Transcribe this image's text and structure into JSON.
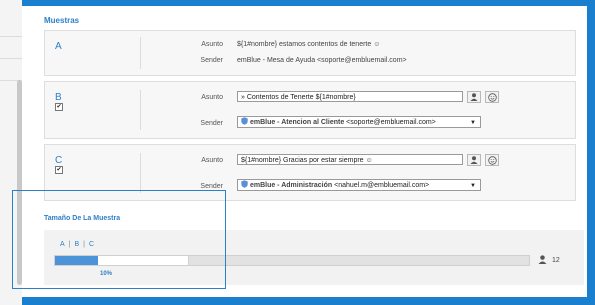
{
  "section_title": "Muestras",
  "samples": [
    {
      "letter": "A",
      "subject_label": "Asunto",
      "subject_value": "${1#nombre} estamos contentos de tenerte ☺",
      "sender_label": "Sender",
      "sender_value": "emBlue - Mesa de Ayuda <soporte@embluemail.com>"
    },
    {
      "letter": "B",
      "checked": true,
      "subject_label": "Asunto",
      "subject_value": "» Contentos de Tenerte ${1#nombre}",
      "sender_label": "Sender",
      "sender_name": "emBlue - Atencion al Cliente",
      "sender_email": "<soporte@embluemail.com>"
    },
    {
      "letter": "C",
      "checked": true,
      "subject_label": "Asunto",
      "subject_value": "${1#nombre} Gracias por estar siempre ☺",
      "sender_label": "Sender",
      "sender_name": "emBlue - Administración",
      "sender_email": "<nahuel.m@embluemail.com>"
    }
  ],
  "sample_size": {
    "title": "Tamaño De La Muestra",
    "tabs": [
      "A",
      "B",
      "C"
    ],
    "percent_label": "10%",
    "fill_fraction": 0.09,
    "white_fraction": 0.19,
    "count": "12"
  },
  "colors": {
    "accent": "#2d7fc7",
    "frame": "#1b7fd0",
    "bar_fill": "#4c93d9"
  },
  "icons": {
    "contact": "person-icon",
    "emoji": "smiley-icon",
    "dropdown": "caret-down-icon",
    "shield": "shield-icon"
  }
}
